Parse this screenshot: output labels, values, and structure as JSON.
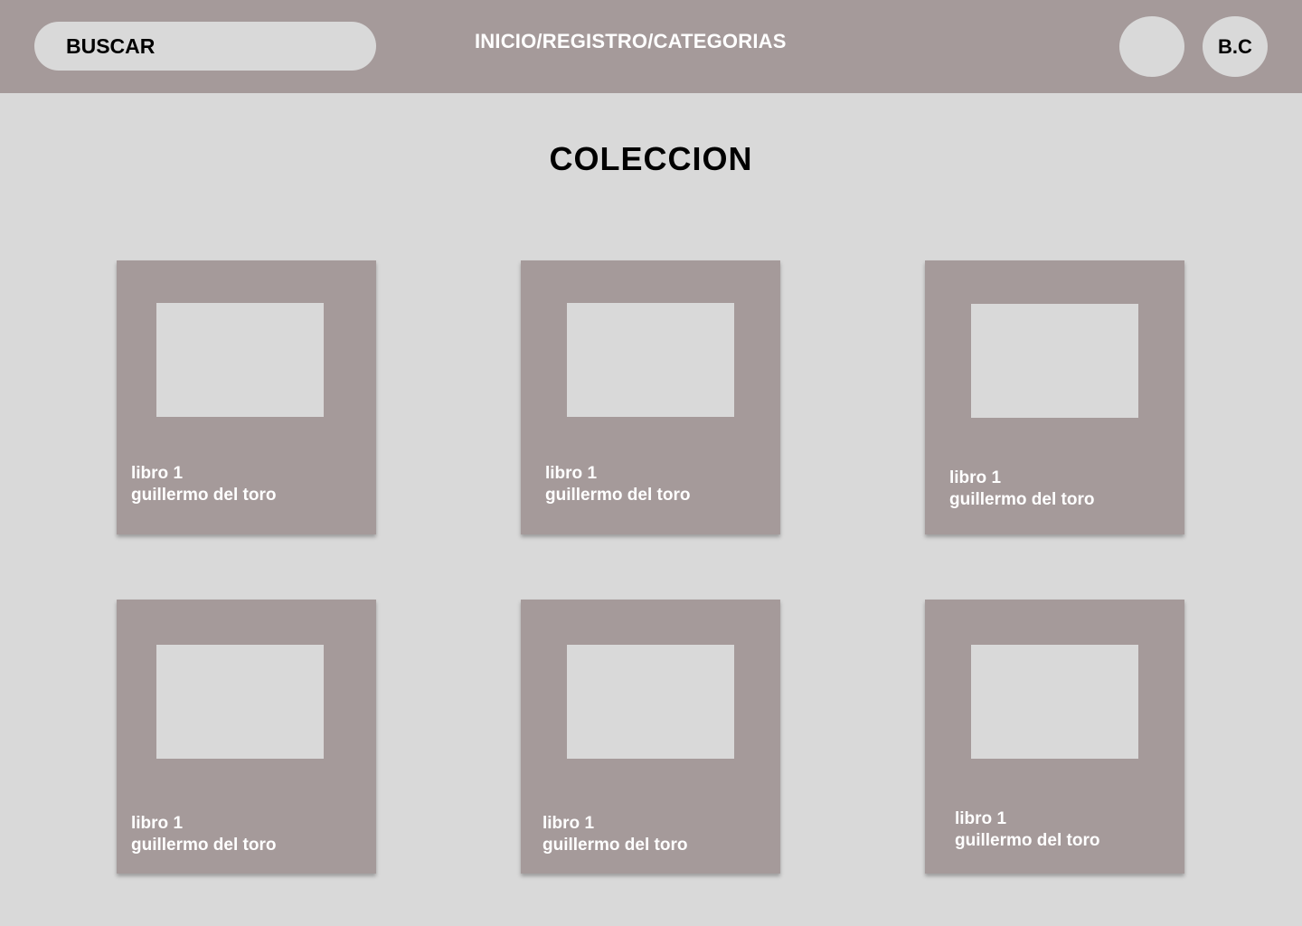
{
  "header": {
    "search_label": "BUSCAR",
    "nav_links": "INICIO/REGISTRO/CATEGORIAS",
    "avatar_blank": "",
    "user_initials": "B.C"
  },
  "main": {
    "title": "COLECCION",
    "cards": [
      {
        "title": "libro 1",
        "author": "guillermo del toro"
      },
      {
        "title": "libro 1",
        "author": "guillermo del toro"
      },
      {
        "title": "libro 1",
        "author": "guillermo del toro"
      },
      {
        "title": "libro 1",
        "author": "guillermo del toro"
      },
      {
        "title": "libro 1",
        "author": "guillermo del toro"
      },
      {
        "title": "libro 1",
        "author": "guillermo del toro"
      }
    ]
  },
  "colors": {
    "background": "#d9d9d9",
    "header": "#a59a9a",
    "card": "#a59a9a",
    "placeholder": "#d9d9d9",
    "card_text": "#ffffff"
  }
}
